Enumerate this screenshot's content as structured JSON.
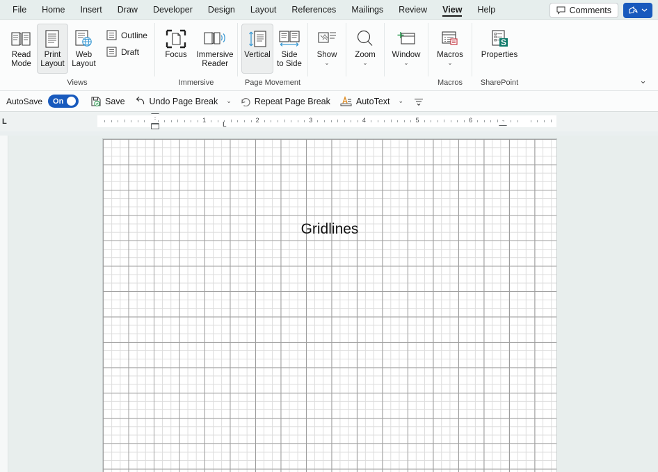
{
  "app": {
    "name": "Microsoft Word",
    "accent_color": "#185abd",
    "ribbon_bg": "#fbfcfc",
    "tabbar_bg": "#e6eeed",
    "canvas_bg": "#e8eeed",
    "grid_major_color": "#9d9d9d",
    "grid_minor_color": "#dcdcdc"
  },
  "tabs": [
    {
      "label": "File",
      "active": false
    },
    {
      "label": "Home",
      "active": false
    },
    {
      "label": "Insert",
      "active": false
    },
    {
      "label": "Draw",
      "active": false
    },
    {
      "label": "Developer",
      "active": false
    },
    {
      "label": "Design",
      "active": false
    },
    {
      "label": "Layout",
      "active": false
    },
    {
      "label": "References",
      "active": false
    },
    {
      "label": "Mailings",
      "active": false
    },
    {
      "label": "Review",
      "active": false
    },
    {
      "label": "View",
      "active": true
    },
    {
      "label": "Help",
      "active": false
    }
  ],
  "tabbar_right": {
    "comments_label": "Comments",
    "comments_icon": "comment-icon",
    "share_icon": "share-icon",
    "share_chevron": "chevron-down-icon"
  },
  "ribbon": {
    "collapse_icon": "chevron-down-icon",
    "groups": [
      {
        "name": "views",
        "label": "Views",
        "big_buttons": [
          {
            "label_line1": "Read",
            "label_line2": "Mode",
            "icon": "read-mode-icon",
            "selected": false
          },
          {
            "label_line1": "Print",
            "label_line2": "Layout",
            "icon": "print-layout-icon",
            "selected": true
          },
          {
            "label_line1": "Web",
            "label_line2": "Layout",
            "icon": "web-layout-icon",
            "selected": false
          }
        ],
        "small_buttons": [
          {
            "label": "Outline",
            "icon": "outline-icon"
          },
          {
            "label": "Draft",
            "icon": "draft-icon"
          }
        ]
      },
      {
        "name": "immersive",
        "label": "Immersive",
        "big_buttons": [
          {
            "label_line1": "Focus",
            "label_line2": "",
            "icon": "focus-icon",
            "selected": false
          },
          {
            "label_line1": "Immersive",
            "label_line2": "Reader",
            "icon": "immersive-reader-icon",
            "selected": false
          }
        ],
        "small_buttons": []
      },
      {
        "name": "page-movement",
        "label": "Page Movement",
        "big_buttons": [
          {
            "label_line1": "Vertical",
            "label_line2": "",
            "icon": "vertical-scroll-icon",
            "selected": true
          },
          {
            "label_line1": "Side",
            "label_line2": "to Side",
            "icon": "side-to-side-icon",
            "selected": false
          }
        ],
        "small_buttons": []
      },
      {
        "name": "show",
        "label": "",
        "big_buttons": [
          {
            "label_line1": "Show",
            "label_line2": "",
            "icon": "show-icon",
            "selected": false,
            "has_chevron": true
          }
        ],
        "small_buttons": []
      },
      {
        "name": "zoom",
        "label": "",
        "big_buttons": [
          {
            "label_line1": "Zoom",
            "label_line2": "",
            "icon": "zoom-magnifier-icon",
            "selected": false,
            "has_chevron": true
          }
        ],
        "small_buttons": []
      },
      {
        "name": "window",
        "label": "",
        "big_buttons": [
          {
            "label_line1": "Window",
            "label_line2": "",
            "icon": "new-window-icon",
            "selected": false,
            "has_chevron": true
          }
        ],
        "small_buttons": []
      },
      {
        "name": "macros",
        "label": "Macros",
        "big_buttons": [
          {
            "label_line1": "Macros",
            "label_line2": "",
            "icon": "macros-icon",
            "selected": false,
            "has_chevron": true
          }
        ],
        "small_buttons": []
      },
      {
        "name": "sharepoint",
        "label": "SharePoint",
        "big_buttons": [
          {
            "label_line1": "Properties",
            "label_line2": "",
            "icon": "sharepoint-properties-icon",
            "selected": false
          }
        ],
        "small_buttons": []
      }
    ]
  },
  "quick_access": {
    "autosave_label": "AutoSave",
    "autosave_state": "On",
    "items": [
      {
        "label": "Save",
        "icon": "save-icon",
        "chevron": false
      },
      {
        "label": "Undo Page Break",
        "icon": "undo-icon",
        "chevron": true
      },
      {
        "label": "Repeat Page Break",
        "icon": "redo-icon",
        "chevron": false
      },
      {
        "label": "AutoText",
        "icon": "autotext-icon",
        "chevron": true
      }
    ],
    "overflow_icon": "more-options-icon"
  },
  "ruler": {
    "numbers": [
      "1",
      "2",
      "3",
      "4",
      "5",
      "6"
    ],
    "left_indent_marker": "indent-marker",
    "right_indent_marker": "right-indent-marker",
    "tab_stop_marker": "tab-stop-marker"
  },
  "document": {
    "body_text": "Gridlines",
    "gridlines_visible": true
  }
}
